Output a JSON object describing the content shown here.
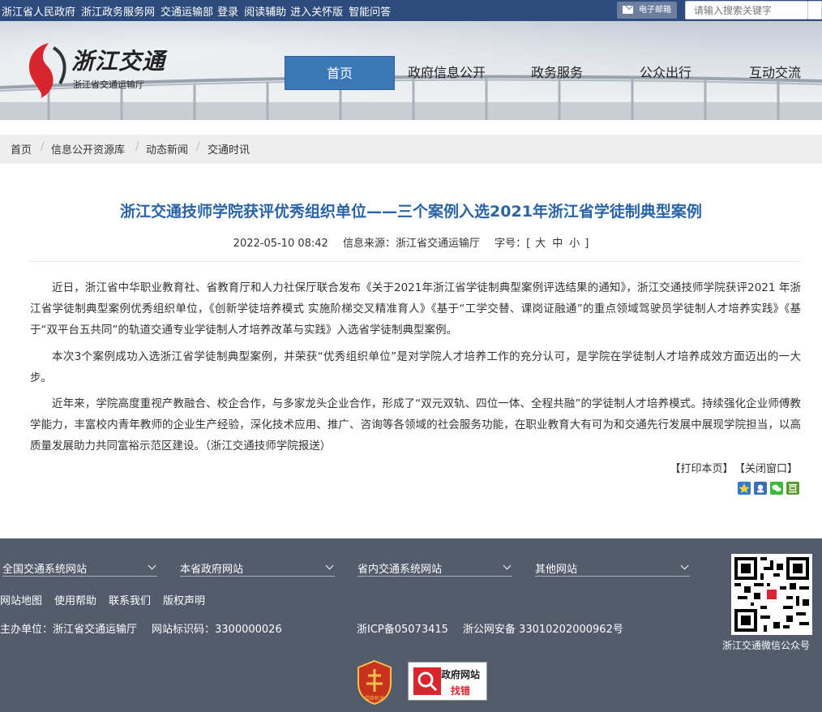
{
  "topbar": {
    "links": [
      "浙江省人民政府",
      "浙江政务服务网",
      "交通运输部",
      "登录",
      "阅读辅助",
      "进入关怀版",
      "智能问答"
    ],
    "mail_label": "电子邮箱",
    "search_placeholder": "请输入搜索关键字"
  },
  "header": {
    "logo_name": "浙江交通",
    "logo_sub": "浙江省交通运输厅",
    "nav": [
      "首页",
      "政府信息公开",
      "政务服务",
      "公众出行",
      "互动交流"
    ],
    "active_nav": "首页"
  },
  "breadcrumb": [
    "首页",
    "信息公开资源库",
    "动态新闻",
    "交通时讯"
  ],
  "article": {
    "title": "浙江交通技师学院获评优秀组织单位——三个案例入选2021年浙江省学徒制典型案例",
    "date": "2022-05-10 08:42",
    "source": "信息来源：浙江省交通运输厅",
    "font_label": "字号：[",
    "font_sizes": [
      "大",
      "中",
      "小"
    ],
    "font_close": "]",
    "paragraphs": [
      "近日，浙江省中华职业教育社、省教育厅和人力社保厅联合发布《关于2021年浙江省学徒制典型案例评选结果的通知》，浙江交通技师学院获评2021 年浙江省学徒制典型案例优秀组织单位，《创新学徒培养模式 实施阶梯交叉精准育人》《基于“工学交替、课岗证融通”的重点领域驾驶员学徒制人才培养实践》《基于“双平台五共同”的轨道交通专业学徒制人才培养改革与实践》入选省学徒制典型案例。",
      "本次3个案例成功入选浙江省学徒制典型案例，并荣获“优秀组织单位”是对学院人才培养工作的充分认可，是学院在学徒制人才培养成效方面迈出的一大步。",
      "近年来，学院高度重视产教融合、校企合作，与多家龙头企业合作，形成了“双元双轨、四位一体、全程共融”的学徒制人才培养模式。持续强化企业师傅教学能力，丰富校内青年教师的企业生产经验，深化技术应用、推广、咨询等各领域的社会服务功能，在职业教育大有可为和交通先行发展中展现学院担当，以高质量发展助力共同富裕示范区建设。（浙江交通技师学院报送）"
    ],
    "print_label": "【打印本页】",
    "close_label": "【关闭窗口】"
  },
  "footer": {
    "selects": [
      "全国交通系统网站",
      "本省政府网站",
      "省内交通系统网站",
      "其他网站"
    ],
    "links": [
      "网站地图",
      "使用帮助",
      "联系我们",
      "版权声明"
    ],
    "host": "主办单位：浙江省交通运输厅",
    "site_code": "网站标识码：3300000026",
    "icp": "浙ICP备05073415",
    "police": "浙公网安备 33010202000962号",
    "qr_caption": "浙江交通微信公众号",
    "badge1_text": "党政机关",
    "badge2_line1": "政府网站",
    "badge2_line2": "找错"
  },
  "colors": {
    "topbar": "#2e4b7d",
    "nav_active": "#3c77b6",
    "title": "#2a64a6",
    "footer": "#535b6d"
  }
}
